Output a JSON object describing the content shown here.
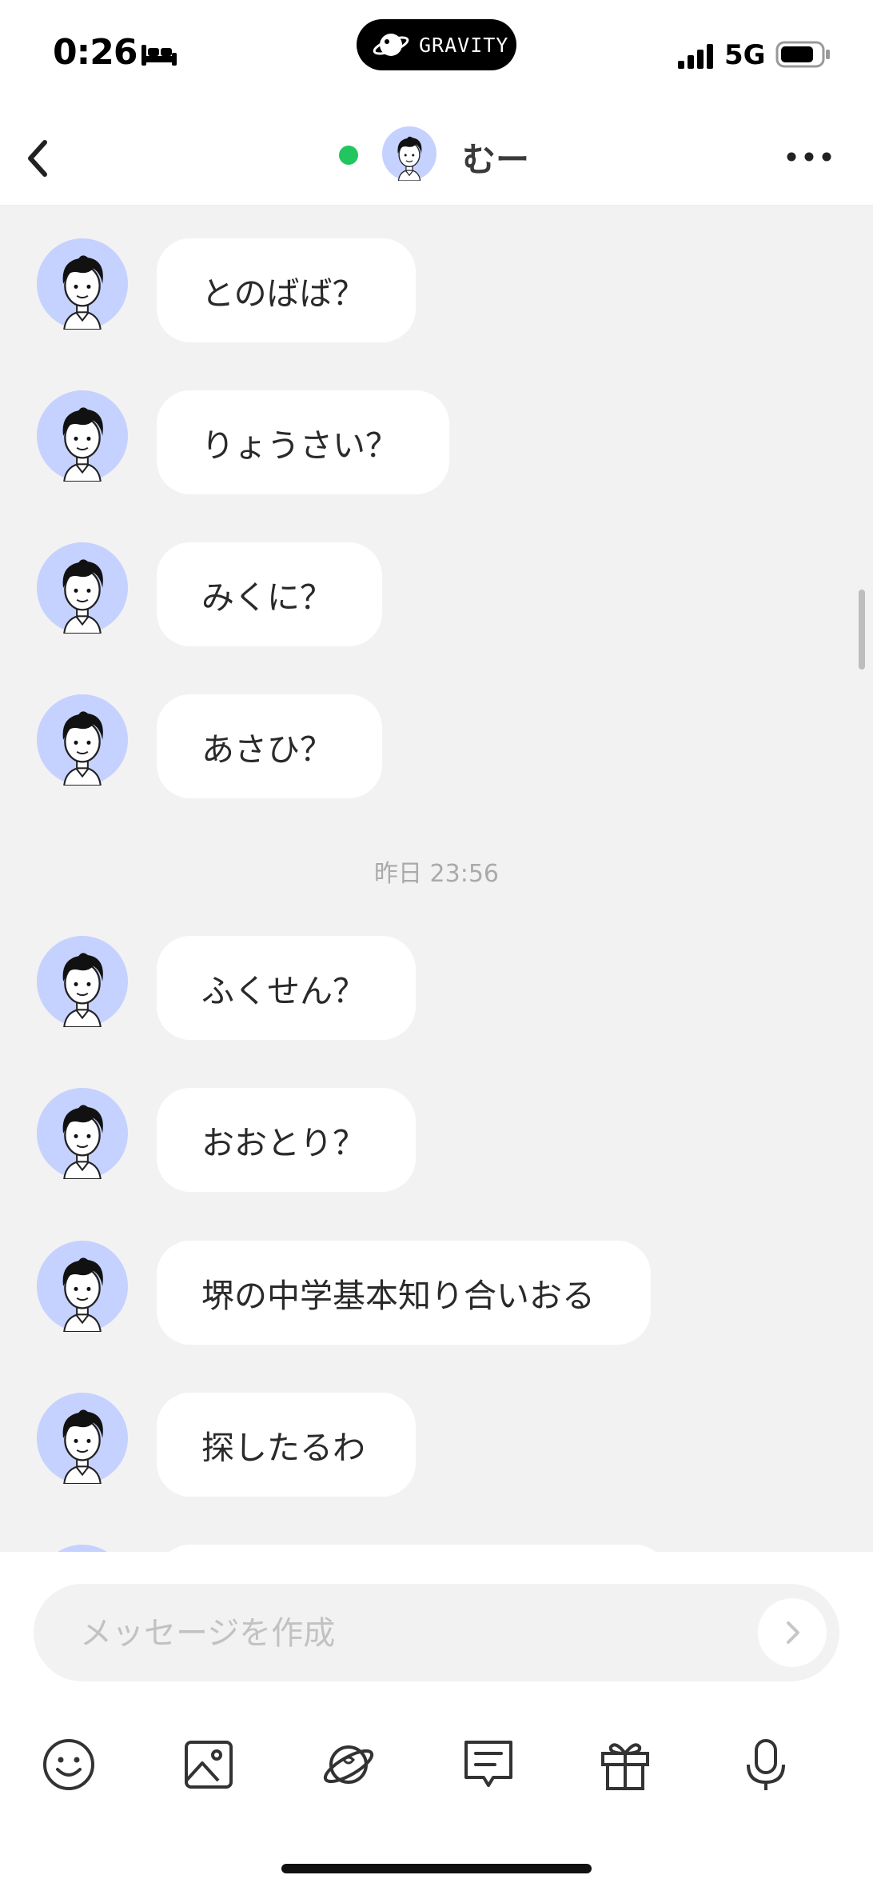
{
  "status_bar": {
    "time": "0:26",
    "network": "5G",
    "island_label": "GRAVITY"
  },
  "header": {
    "name": "むー",
    "online": true
  },
  "messages_before": [
    {
      "text": "とのばば？"
    },
    {
      "text": "りょうさい？"
    },
    {
      "text": "みくに？"
    },
    {
      "text": "あさひ？"
    }
  ],
  "timestamp": "昨日 23:56",
  "messages_after": [
    {
      "text": "ふくせん？"
    },
    {
      "text": "おおとり？"
    },
    {
      "text": "堺の中学基本知り合いおる"
    },
    {
      "text": "探したるわ"
    }
  ],
  "compose": {
    "placeholder": "メッセージを作成",
    "value": ""
  },
  "toolbar": {
    "icons": [
      "smile-icon",
      "image-icon",
      "planet-sticker-icon",
      "message-icon",
      "gift-icon",
      "microphone-icon"
    ]
  },
  "colors": {
    "online": "#22c55e",
    "avatar_bg": "#c5d1ff",
    "chat_bg": "#f2f2f2"
  }
}
